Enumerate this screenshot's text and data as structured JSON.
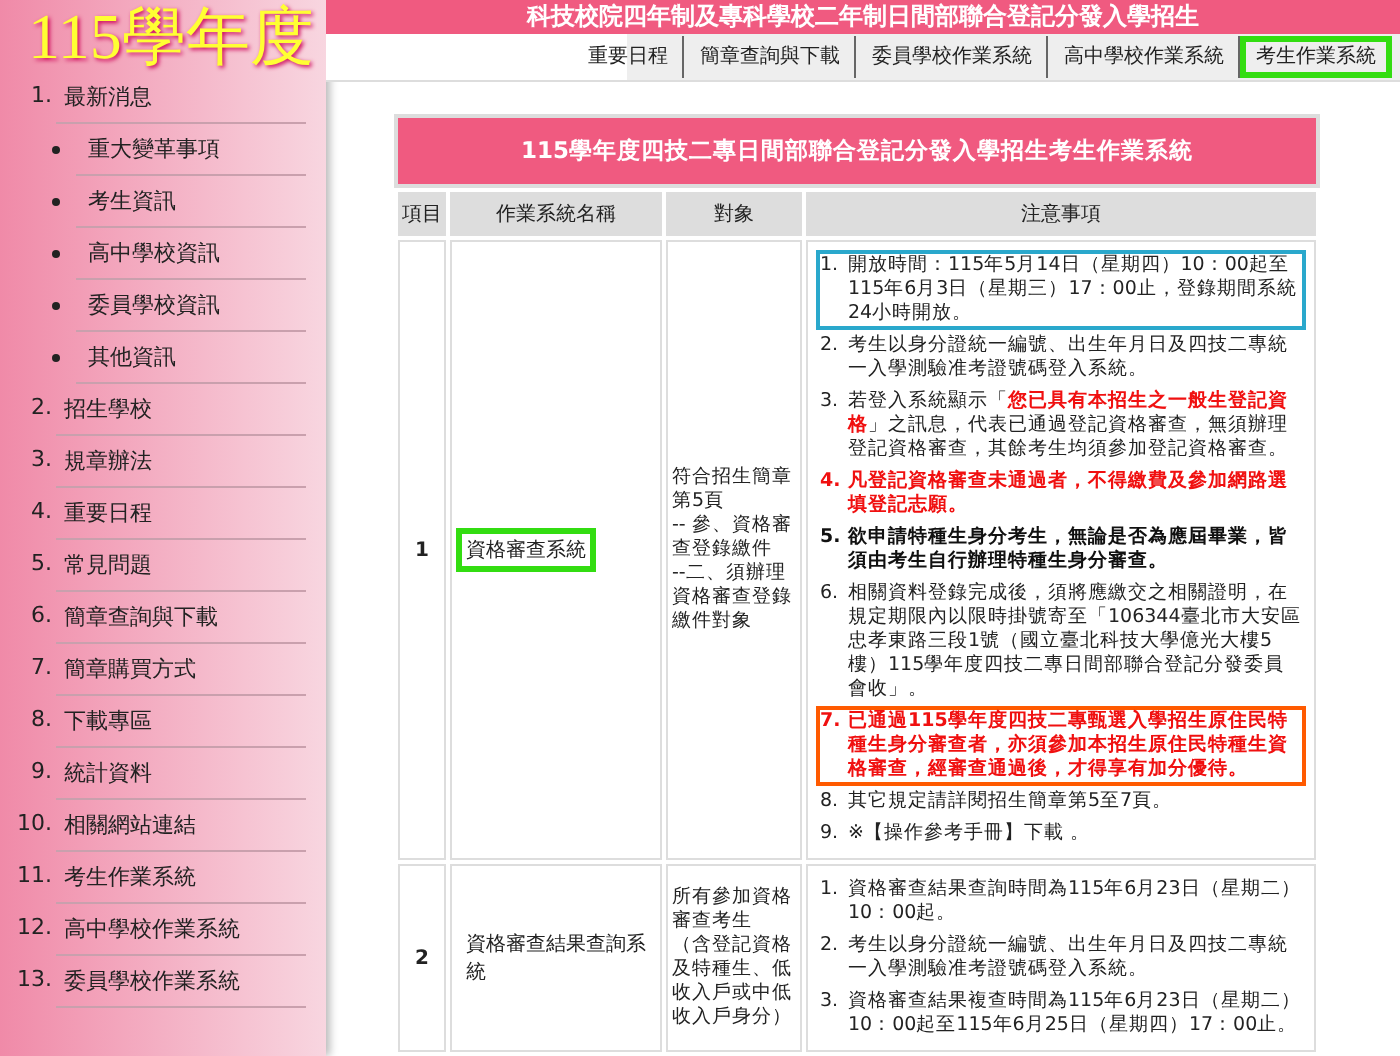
{
  "logo": "115學年度",
  "banner_title": "科技校院四年制及專科學校二年制日間部聯合登記分發入學招生",
  "top_nav": [
    {
      "label": "重要日程"
    },
    {
      "label": "簡章查詢與下載"
    },
    {
      "label": "委員學校作業系統"
    },
    {
      "label": "高中學校作業系統"
    },
    {
      "label": "考生作業系統",
      "color": "#33dd11"
    }
  ],
  "sidebar": {
    "items": [
      {
        "number": "1.",
        "label": "最新消息",
        "children": [
          {
            "label": "重大變革事項"
          },
          {
            "label": "考生資訊"
          },
          {
            "label": "高中學校資訊"
          },
          {
            "label": "委員學校資訊"
          },
          {
            "label": "其他資訊"
          }
        ]
      },
      {
        "number": "2.",
        "label": "招生學校"
      },
      {
        "number": "3.",
        "label": "規章辦法"
      },
      {
        "number": "4.",
        "label": "重要日程"
      },
      {
        "number": "5.",
        "label": "常見問題"
      },
      {
        "number": "6.",
        "label": "簡章查詢與下載"
      },
      {
        "number": "7.",
        "label": "簡章購買方式"
      },
      {
        "number": "8.",
        "label": "下載專區"
      },
      {
        "number": "9.",
        "label": "統計資料"
      },
      {
        "number": "10.",
        "label": "相關網站連結"
      },
      {
        "number": "11.",
        "label": "考生作業系統"
      },
      {
        "number": "12.",
        "label": "高中學校作業系統"
      },
      {
        "number": "13.",
        "label": "委員學校作業系統"
      }
    ]
  },
  "table": {
    "title": "115學年度四技二專日間部聯合登記分發入學招生考生作業系統",
    "columns": [
      "項目",
      "作業系統名稱",
      "對象",
      "注意事項"
    ],
    "rows": [
      {
        "item": "1",
        "name": {
          "text": "資格審查系統",
          "color": "#33dd11"
        },
        "target": [
          "符合招生簡章第5頁",
          "-- 參、資格審查登錄繳件",
          "--二、須辦理資格審查登錄繳件對象"
        ],
        "notes": [
          {
            "number": "1.",
            "kind": "normal",
            "text": "開放時間：115年5月14日（星期四）10：00起至115年6月3日（星期三）17：00止，登錄期間系統24小時開放。",
            "color": "#2aa8cc"
          },
          {
            "number": "2.",
            "kind": "normal",
            "text": "考生以身分證統一編號、出生年月日及四技二專統一入學測驗准考證號碼登入系統。"
          },
          {
            "number": "3.",
            "kind": "mixed",
            "text": "若登入系統顯示「**您已具有本招生之一般生登記資格**」之訊息，代表已通過登記資格審查，無須辦理登記資格審查，其餘考生均須參加登記資格審查。"
          },
          {
            "number": "4.",
            "kind": "red",
            "text": "凡登記資格審查未通過者，不得繳費及參加網路選填登記志願。"
          },
          {
            "number": "5.",
            "kind": "bold",
            "text": "欲申請特種生身分考生，無論是否為應屆畢業，皆須由考生自行辦理特種生身分審查。"
          },
          {
            "number": "6.",
            "kind": "normal",
            "text": "相關資料登錄完成後，須將應繳交之相關證明，在規定期限內以限時掛號寄至「106344臺北市大安區忠孝東路三段1號（國立臺北科技大學億光大樓5樓）115學年度四技二專日間部聯合登記分發委員會收」。"
          },
          {
            "number": "7.",
            "kind": "red",
            "text": "已通過115學年度四技二專甄選入學招生原住民特種生身分審查者，亦須參加本招生原住民特種生資格審查，經審查通過後，才得享有加分優待。",
            "color": "#ff5a00"
          },
          {
            "number": "8.",
            "kind": "normal",
            "text": "其它規定請詳閱招生簡章第5至7頁。"
          },
          {
            "number": "9.",
            "kind": "normal",
            "text": "※【操作參考手冊】下載 。"
          }
        ]
      },
      {
        "item": "2",
        "name": {
          "text": "資格審查結果查詢系統"
        },
        "target": [
          "所有參加資格審查考生",
          "（含登記資格及特種生、低收入戶或中低收入戶身分）"
        ],
        "notes": [
          {
            "number": "1.",
            "kind": "normal",
            "text": "資格審查結果查詢時間為115年6月23日（星期二）10：00起。"
          },
          {
            "number": "2.",
            "kind": "normal",
            "text": "考生以身分證統一編號、出生年月日及四技二專統一入學測驗准考證號碼登入系統。"
          },
          {
            "number": "3.",
            "kind": "normal",
            "text": "資格審查結果複查時間為115年6月23日（星期二）10：00起至115年6月25日（星期四）17：00止。"
          }
        ]
      }
    ]
  }
}
